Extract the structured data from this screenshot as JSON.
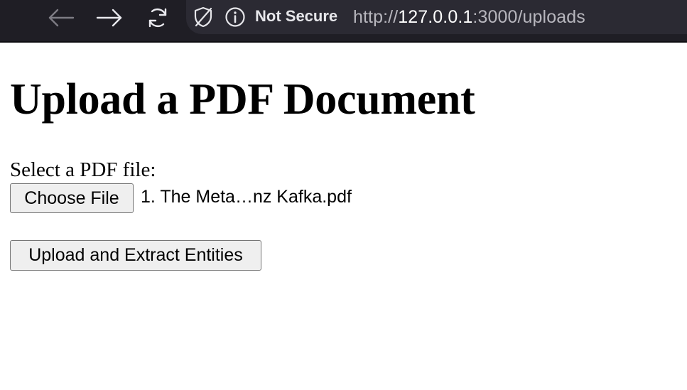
{
  "browser": {
    "security_label": "Not Secure",
    "url": {
      "scheme": "http://",
      "host": "127.0.0.1",
      "rest": ":3000/uploads"
    },
    "icons": {
      "back": "arrow-left-icon",
      "forward": "arrow-right-icon",
      "reload": "reload-icon",
      "tracking": "shield-slash-icon",
      "info": "info-icon"
    },
    "colors": {
      "toolbar_bg": "#1f1e25",
      "urlbar_bg": "#2b2a33"
    }
  },
  "page": {
    "title": "Upload a PDF Document",
    "file_label": "Select a PDF file:",
    "choose_file_label": "Choose File",
    "selected_file_name": "1. The Meta…nz Kafka.pdf",
    "submit_label": "Upload and Extract Entities"
  }
}
